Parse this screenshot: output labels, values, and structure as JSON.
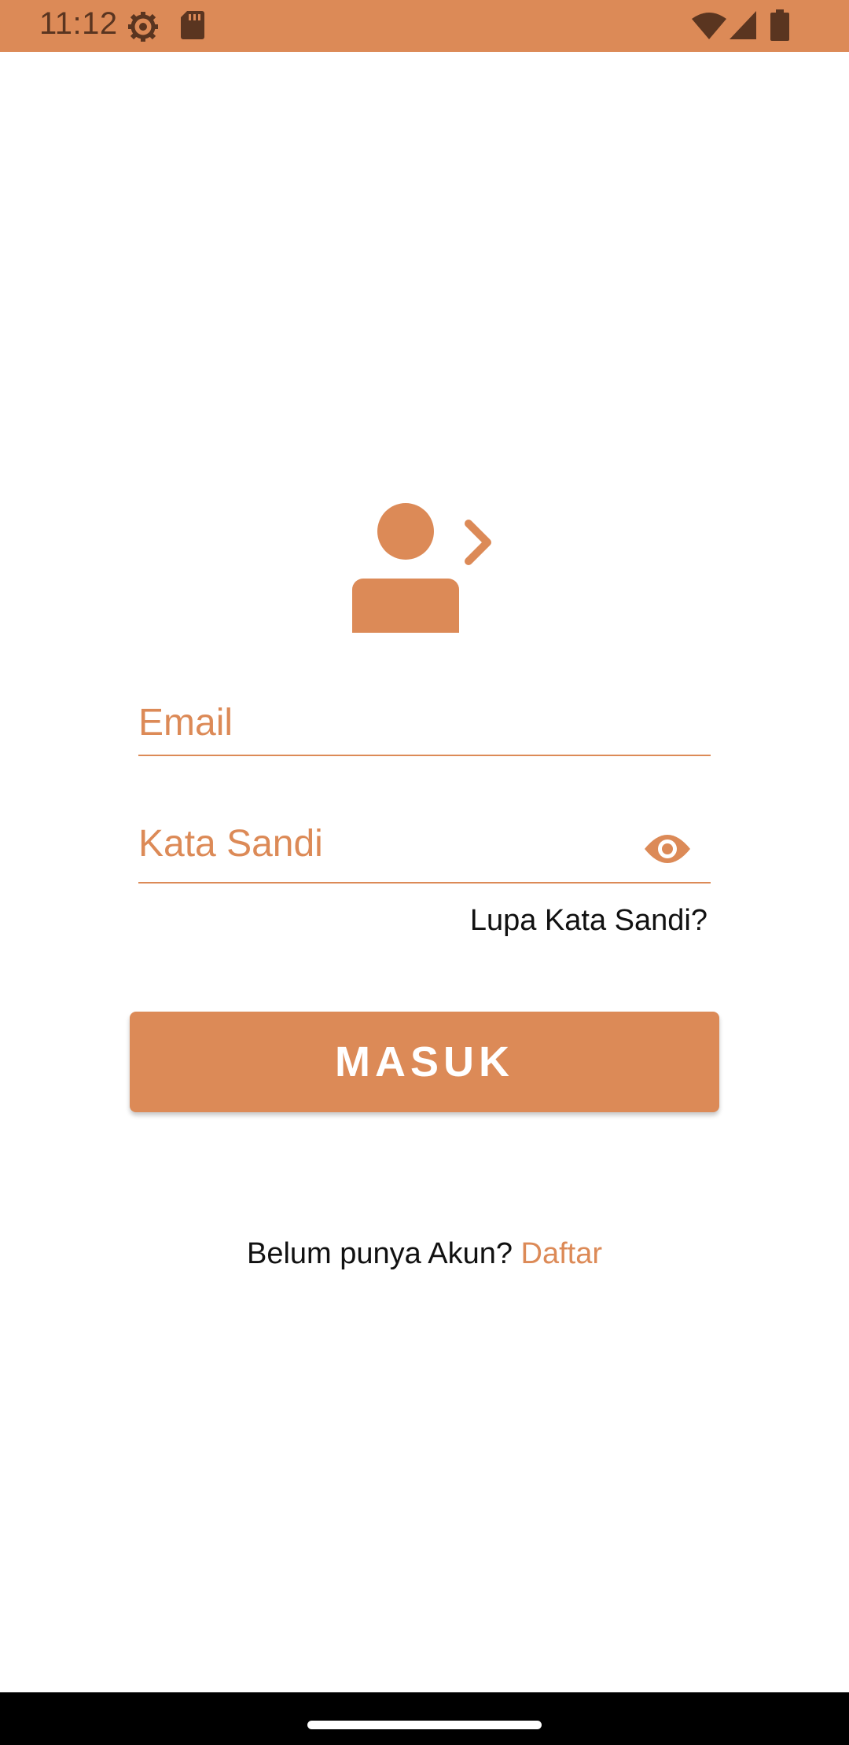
{
  "status_bar": {
    "time": "11:12",
    "icons_left": [
      "settings-icon",
      "sd-card-icon"
    ],
    "icons_right": [
      "wifi-icon",
      "signal-icon",
      "battery-icon"
    ],
    "background": "#DC8A57"
  },
  "login": {
    "header_icon": "user-login-icon",
    "email_placeholder": "Email",
    "password_placeholder": "Kata Sandi",
    "password_toggle_icon": "eye-icon",
    "forgot_password": "Lupa Kata Sandi?",
    "login_button": "MASUK",
    "signup_prompt": "Belum punya Akun?",
    "signup_link": "Daftar"
  },
  "colors": {
    "accent": "#DC8A57",
    "text": "#111111",
    "background": "#FFFFFF"
  }
}
